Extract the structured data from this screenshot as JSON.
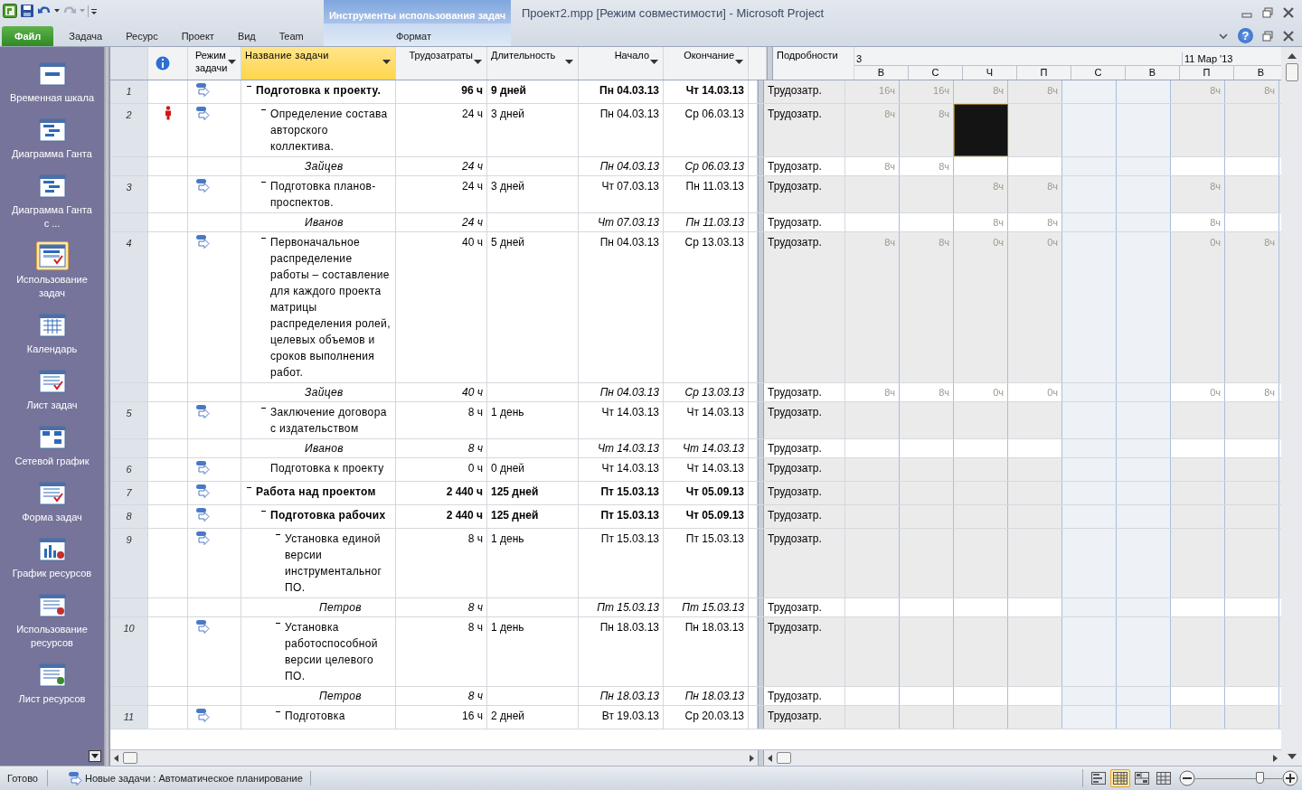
{
  "window": {
    "title": "Проект2.mpp [Режим совместимости]  -  Microsoft Project"
  },
  "ribbon": {
    "tabs": [
      {
        "label": "Файл",
        "kind": "file",
        "selected": false
      },
      {
        "label": "Задача",
        "kind": "tab",
        "selected": false
      },
      {
        "label": "Ресурс",
        "kind": "tab",
        "selected": false
      },
      {
        "label": "Проект",
        "kind": "tab",
        "selected": false
      },
      {
        "label": "Вид",
        "kind": "tab",
        "selected": false
      },
      {
        "label": "Team",
        "kind": "tab",
        "selected": false
      }
    ],
    "contextual_group": {
      "label": "Инструменты использования задач",
      "tabs": [
        {
          "label": "Формат",
          "selected": false
        }
      ]
    },
    "help_button": {
      "label": "?"
    }
  },
  "sidebar": {
    "items": [
      {
        "label": "Временная шкала",
        "selected": false
      },
      {
        "label": "Диаграмма Ганта",
        "selected": false
      },
      {
        "label": "Диаграмма Ганта с ...",
        "selected": false
      },
      {
        "label": "Использование задач",
        "selected": true
      },
      {
        "label": "Календарь",
        "selected": false
      },
      {
        "label": "Лист задач",
        "selected": false
      },
      {
        "label": "Сетевой график",
        "selected": false
      },
      {
        "label": "Форма задач",
        "selected": false
      },
      {
        "label": "График ресурсов",
        "selected": false
      },
      {
        "label": "Использование ресурсов",
        "selected": false
      },
      {
        "label": "Лист ресурсов",
        "selected": false
      }
    ]
  },
  "table": {
    "columns": [
      {
        "label": "Режим задачи",
        "filter": true,
        "selected": false
      },
      {
        "label": "Название задачи",
        "filter": true,
        "selected": true
      },
      {
        "label": "Трудозатраты",
        "filter": true,
        "selected": false
      },
      {
        "label": "Длительность",
        "filter": true,
        "selected": false
      },
      {
        "label": "Начало",
        "filter": true,
        "selected": false
      },
      {
        "label": "Окончание",
        "filter": true,
        "selected": false
      }
    ],
    "rows": [
      {
        "kind": "task",
        "id": "1",
        "overallocated": false,
        "summary": true,
        "expanded": true,
        "name": "Подготовка к проекту.",
        "work": "96 ч",
        "duration": "9 дней",
        "start": "Пн 04.03.13",
        "finish": "Чт 14.03.13",
        "details": "Трудозатр.",
        "cells": [
          {
            "value": "16ч",
            "selected": false
          },
          {
            "value": "16ч",
            "selected": false
          },
          {
            "value": "8ч",
            "selected": false
          },
          {
            "value": "8ч",
            "selected": false
          },
          {
            "selected": false
          },
          {
            "selected": false
          },
          {
            "value": "8ч",
            "selected": false
          },
          {
            "value": "8ч",
            "selected": false
          }
        ],
        "children": [
          {
            "kind": "task",
            "id": "2",
            "overallocated": true,
            "summary": false,
            "expanded": true,
            "name": "Определение состава авторского коллектива.",
            "work": "24 ч",
            "duration": "3 дней",
            "start": "Пн 04.03.13",
            "finish": "Ср 06.03.13",
            "details": "Трудозатр.",
            "cells": [
              {
                "value": "8ч",
                "selected": false
              },
              {
                "value": "8ч",
                "selected": false
              },
              {
                "selected": true
              },
              {
                "selected": false
              },
              {
                "selected": false
              },
              {
                "selected": false
              },
              {
                "selected": false
              },
              {
                "selected": false
              }
            ],
            "children": [
              {
                "kind": "assignment",
                "name": "Зайцев",
                "work": "24 ч",
                "start": "Пн 04.03.13",
                "finish": "Ср 06.03.13",
                "details": "Трудозатр.",
                "cells": [
                  {
                    "value": "8ч",
                    "selected": false
                  },
                  {
                    "value": "8ч",
                    "selected": false
                  },
                  {
                    "selected": false
                  },
                  {
                    "selected": false
                  },
                  {
                    "selected": false
                  },
                  {
                    "selected": false
                  },
                  {
                    "selected": false
                  },
                  {
                    "selected": false
                  }
                ]
              }
            ]
          },
          {
            "kind": "task",
            "id": "3",
            "overallocated": false,
            "summary": false,
            "expanded": true,
            "name": "Подготовка планов-проспектов.",
            "work": "24 ч",
            "duration": "3 дней",
            "start": "Чт 07.03.13",
            "finish": "Пн 11.03.13",
            "details": "Трудозатр.",
            "cells": [
              {
                "selected": false
              },
              {
                "selected": false
              },
              {
                "value": "8ч",
                "selected": false
              },
              {
                "value": "8ч",
                "selected": false
              },
              {
                "selected": false
              },
              {
                "selected": false
              },
              {
                "value": "8ч",
                "selected": false
              },
              {
                "selected": false
              }
            ],
            "children": [
              {
                "kind": "assignment",
                "name": "Иванов",
                "work": "24 ч",
                "start": "Чт 07.03.13",
                "finish": "Пн 11.03.13",
                "details": "Трудозатр.",
                "cells": [
                  {
                    "selected": false
                  },
                  {
                    "selected": false
                  },
                  {
                    "value": "8ч",
                    "selected": false
                  },
                  {
                    "value": "8ч",
                    "selected": false
                  },
                  {
                    "selected": false
                  },
                  {
                    "selected": false
                  },
                  {
                    "value": "8ч",
                    "selected": false
                  },
                  {
                    "selected": false
                  }
                ]
              }
            ]
          },
          {
            "kind": "task",
            "id": "4",
            "overallocated": false,
            "summary": false,
            "expanded": true,
            "name": "Первоначальное распределение работы – составление для каждого проекта матрицы распределения ролей, целевых объемов и сроков выполнения работ.",
            "work": "40 ч",
            "duration": "5 дней",
            "start": "Пн 04.03.13",
            "finish": "Ср 13.03.13",
            "details": "Трудозатр.",
            "cells": [
              {
                "value": "8ч",
                "selected": false
              },
              {
                "value": "8ч",
                "selected": false
              },
              {
                "value": "0ч",
                "selected": false
              },
              {
                "value": "0ч",
                "selected": false
              },
              {
                "selected": false
              },
              {
                "selected": false
              },
              {
                "value": "0ч",
                "selected": false
              },
              {
                "value": "8ч",
                "selected": false
              }
            ],
            "children": [
              {
                "kind": "assignment",
                "name": "Зайцев",
                "work": "40 ч",
                "start": "Пн 04.03.13",
                "finish": "Ср 13.03.13",
                "details": "Трудозатр.",
                "cells": [
                  {
                    "value": "8ч",
                    "selected": false
                  },
                  {
                    "value": "8ч",
                    "selected": false
                  },
                  {
                    "value": "0ч",
                    "selected": false
                  },
                  {
                    "value": "0ч",
                    "selected": false
                  },
                  {
                    "selected": false
                  },
                  {
                    "selected": false
                  },
                  {
                    "value": "0ч",
                    "selected": false
                  },
                  {
                    "value": "8ч",
                    "selected": false
                  }
                ]
              }
            ]
          },
          {
            "kind": "task",
            "id": "5",
            "overallocated": false,
            "summary": false,
            "expanded": true,
            "name": "Заключение договора с издательством",
            "work": "8 ч",
            "duration": "1 день",
            "start": "Чт 14.03.13",
            "finish": "Чт 14.03.13",
            "details": "Трудозатр.",
            "children": [
              {
                "kind": "assignment",
                "name": "Иванов",
                "work": "8 ч",
                "start": "Чт 14.03.13",
                "finish": "Чт 14.03.13",
                "details": "Трудозатр."
              }
            ]
          },
          {
            "kind": "task",
            "id": "6",
            "overallocated": false,
            "summary": false,
            "name": "Подготовка к проекту",
            "work": "0 ч",
            "duration": "0 дней",
            "start": "Чт 14.03.13",
            "finish": "Чт 14.03.13",
            "details": "Трудозатр."
          }
        ]
      },
      {
        "kind": "task",
        "id": "7",
        "overallocated": false,
        "summary": true,
        "expanded": true,
        "name": "Работа над проектом",
        "work": "2 440 ч",
        "duration": "125 дней",
        "start": "Пт 15.03.13",
        "finish": "Чт 05.09.13",
        "details": "Трудозатр.",
        "children": [
          {
            "kind": "task",
            "id": "8",
            "overallocated": false,
            "summary": true,
            "expanded": true,
            "name": "Подготовка рабочих",
            "work": "2 440 ч",
            "duration": "125 дней",
            "start": "Пт 15.03.13",
            "finish": "Чт 05.09.13",
            "details": "Трудозатр.",
            "children": [
              {
                "kind": "task",
                "id": "9",
                "overallocated": false,
                "summary": false,
                "expanded": true,
                "name": "Установка единой версии инструментальног ПО.",
                "work": "8 ч",
                "duration": "1 день",
                "start": "Пт 15.03.13",
                "finish": "Пт 15.03.13",
                "details": "Трудозатр.",
                "children": [
                  {
                    "kind": "assignment",
                    "name": "Петров",
                    "work": "8 ч",
                    "start": "Пт 15.03.13",
                    "finish": "Пт 15.03.13",
                    "details": "Трудозатр."
                  }
                ]
              },
              {
                "kind": "task",
                "id": "10",
                "overallocated": false,
                "summary": false,
                "expanded": true,
                "name": "Установка работоспособной версии целевого ПО.",
                "work": "8 ч",
                "duration": "1 день",
                "start": "Пн 18.03.13",
                "finish": "Пн 18.03.13",
                "details": "Трудозатр.",
                "children": [
                  {
                    "kind": "assignment",
                    "name": "Петров",
                    "work": "8 ч",
                    "start": "Пн 18.03.13",
                    "finish": "Пн 18.03.13",
                    "details": "Трудозатр."
                  }
                ]
              },
              {
                "kind": "task",
                "id": "11",
                "overallocated": false,
                "summary": false,
                "expanded": true,
                "name": "Подготовка",
                "work": "16 ч",
                "duration": "2 дней",
                "start": "Вт 19.03.13",
                "finish": "Ср 20.03.13",
                "details": "Трудозатр."
              }
            ]
          }
        ]
      }
    ]
  },
  "timescale": {
    "details_header": "Подробности",
    "top_tier": [
      "3",
      "11 Мар '13"
    ],
    "days": [
      {
        "label": "В",
        "weekend": false
      },
      {
        "label": "С",
        "weekend": false
      },
      {
        "label": "Ч",
        "weekend": false
      },
      {
        "label": "П",
        "weekend": false
      },
      {
        "label": "С",
        "weekend": true
      },
      {
        "label": "В",
        "weekend": true
      },
      {
        "label": "П",
        "weekend": false
      },
      {
        "label": "В",
        "weekend": false
      }
    ]
  },
  "status_bar": {
    "ready": "Готово",
    "new_tasks": "Новые задачи : Автоматическое планирование",
    "view_buttons": [
      {
        "selected": false
      },
      {
        "selected": true
      },
      {
        "selected": false
      },
      {
        "selected": false
      }
    ],
    "zoom": {
      "level": 0.74
    }
  }
}
